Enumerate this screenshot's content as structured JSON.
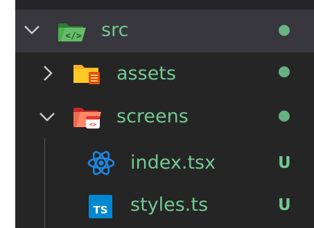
{
  "tree": {
    "items": [
      {
        "label": "src",
        "expanded": true,
        "icon": "folder-src-open-icon",
        "decoration": "modified-dot"
      },
      {
        "label": "assets",
        "expanded": false,
        "icon": "folder-assets-icon",
        "decoration": "modified-dot"
      },
      {
        "label": "screens",
        "expanded": true,
        "icon": "folder-screens-open-icon",
        "decoration": "modified-dot"
      },
      {
        "label": "index.tsx",
        "icon": "react-icon",
        "badge": "U"
      },
      {
        "label": "styles.ts",
        "icon": "typescript-icon",
        "badge": "U"
      }
    ]
  },
  "colors": {
    "background": "#252526",
    "selected_row": "#37373d",
    "git_untracked": "#73c991",
    "folder_src": "#4caf50",
    "folder_assets": "#f9b31e",
    "folder_screens": "#ee6b4d",
    "react": "#1e88e5",
    "typescript": "#0288d1"
  }
}
